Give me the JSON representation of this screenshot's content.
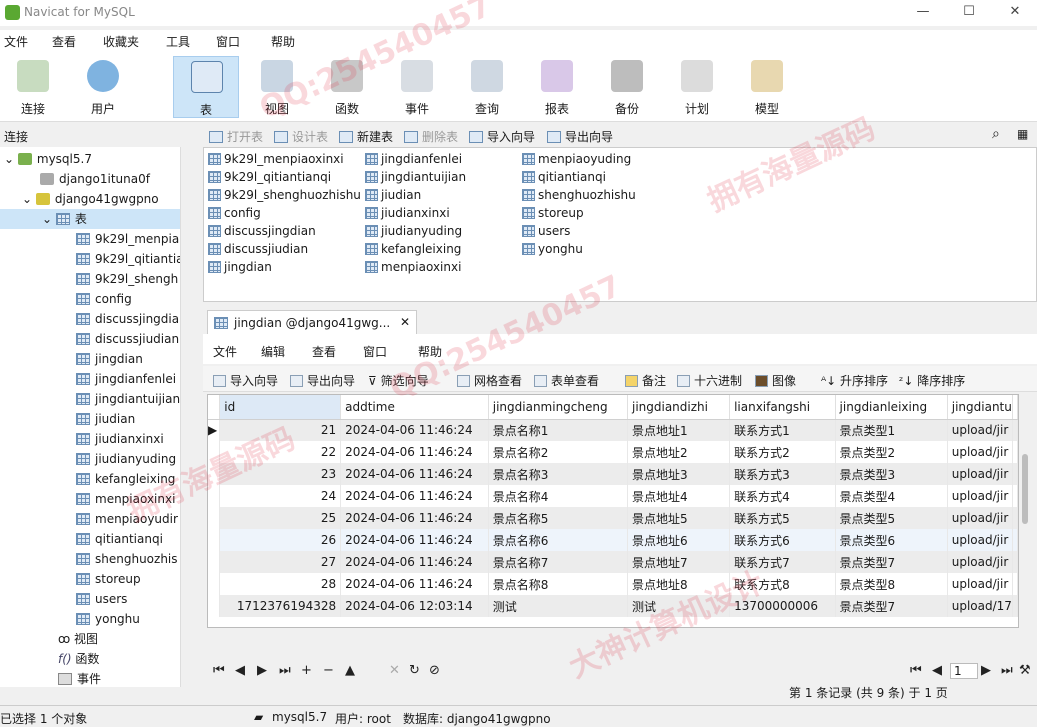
{
  "window": {
    "title": "Navicat for MySQL",
    "min": "—",
    "max": "☐",
    "close": "✕"
  },
  "menu": [
    "文件",
    "查看",
    "收藏夹",
    "工具",
    "窗口",
    "帮助"
  ],
  "toolbar": [
    {
      "label": "连接",
      "icon": "connect-icon"
    },
    {
      "label": "用户",
      "icon": "user-icon"
    },
    {
      "label": "表",
      "icon": "table-icon"
    },
    {
      "label": "视图",
      "icon": "view-icon"
    },
    {
      "label": "函数",
      "icon": "function-icon"
    },
    {
      "label": "事件",
      "icon": "event-icon"
    },
    {
      "label": "查询",
      "icon": "query-icon"
    },
    {
      "label": "报表",
      "icon": "report-icon"
    },
    {
      "label": "备份",
      "icon": "backup-icon"
    },
    {
      "label": "计划",
      "icon": "schedule-icon"
    },
    {
      "label": "模型",
      "icon": "model-icon"
    }
  ],
  "connections_header": "连接",
  "tree": {
    "server": "mysql5.7",
    "dbs": [
      "django1ituna0f",
      "django41gwgpno"
    ],
    "tables_label": "表",
    "tables": [
      "9k29l_menpia",
      "9k29l_qitiantia",
      "9k29l_shengh",
      "config",
      "discussjingdia",
      "discussjiudian",
      "jingdian",
      "jingdianfenlei",
      "jingdiantuijian",
      "jiudian",
      "jiudianxinxi",
      "jiudianyuding",
      "kefangleixing",
      "menpiaoxinxi",
      "menpiaoyudir",
      "qitiantianqi",
      "shenghuozhis",
      "storeup",
      "users",
      "yonghu"
    ],
    "views_label": "视图",
    "functions_label": "函数",
    "events_label": "事件"
  },
  "objbar": {
    "open": "打开表",
    "design": "设计表",
    "new": "新建表",
    "delete": "删除表",
    "import": "导入向导",
    "export": "导出向导"
  },
  "objects": [
    "9k29l_menpiaoxinxi",
    "9k29l_qitiantianqi",
    "9k29l_shenghuozhishu",
    "config",
    "discussjingdian",
    "discussjiudian",
    "jingdian",
    "jingdianfenlei",
    "jingdiantuijian",
    "jiudian",
    "jiudianxinxi",
    "jiudianyuding",
    "kefangleixing",
    "menpiaoxinxi",
    "menpiaoyuding",
    "qitiantianqi",
    "shenghuozhishu",
    "storeup",
    "users",
    "yonghu"
  ],
  "datatab": {
    "tab_title": "jingdian @django41gwg...",
    "menu": [
      "文件",
      "编辑",
      "查看",
      "窗口",
      "帮助"
    ],
    "tools": [
      "导入向导",
      "导出向导",
      "筛选向导",
      "网格查看",
      "表单查看",
      "备注",
      "十六进制",
      "图像",
      "升序排序",
      "降序排序"
    ]
  },
  "grid": {
    "columns": [
      "id",
      "addtime",
      "jingdianmingcheng",
      "jingdiandizhi",
      "lianxifangshi",
      "jingdianleixing",
      "jingdiantu"
    ],
    "rows": [
      [
        "21",
        "2024-04-06 11:46:24",
        "景点名称1",
        "景点地址1",
        "联系方式1",
        "景点类型1",
        "upload/jir"
      ],
      [
        "22",
        "2024-04-06 11:46:24",
        "景点名称2",
        "景点地址2",
        "联系方式2",
        "景点类型2",
        "upload/jir"
      ],
      [
        "23",
        "2024-04-06 11:46:24",
        "景点名称3",
        "景点地址3",
        "联系方式3",
        "景点类型3",
        "upload/jir"
      ],
      [
        "24",
        "2024-04-06 11:46:24",
        "景点名称4",
        "景点地址4",
        "联系方式4",
        "景点类型4",
        "upload/jir"
      ],
      [
        "25",
        "2024-04-06 11:46:24",
        "景点名称5",
        "景点地址5",
        "联系方式5",
        "景点类型5",
        "upload/jir"
      ],
      [
        "26",
        "2024-04-06 11:46:24",
        "景点名称6",
        "景点地址6",
        "联系方式6",
        "景点类型6",
        "upload/jir"
      ],
      [
        "27",
        "2024-04-06 11:46:24",
        "景点名称7",
        "景点地址7",
        "联系方式7",
        "景点类型7",
        "upload/jir"
      ],
      [
        "28",
        "2024-04-06 11:46:24",
        "景点名称8",
        "景点地址8",
        "联系方式8",
        "景点类型8",
        "upload/jir"
      ],
      [
        "1712376194328",
        "2024-04-06 12:03:14",
        "测试",
        "测试",
        "13700000006",
        "景点类型7",
        "upload/17"
      ]
    ]
  },
  "nav": {
    "page": "1",
    "record_info": "第 1 条记录 (共 9 条) 于 1 页"
  },
  "status": {
    "selected": "已选择 1 个对象",
    "conn": "mysql5.7",
    "user": "用户: root",
    "db": "数据库: django41gwgpno"
  },
  "watermarks": [
    "QQ:254540457",
    "拥有海量源码",
    "大神计算机设计"
  ]
}
